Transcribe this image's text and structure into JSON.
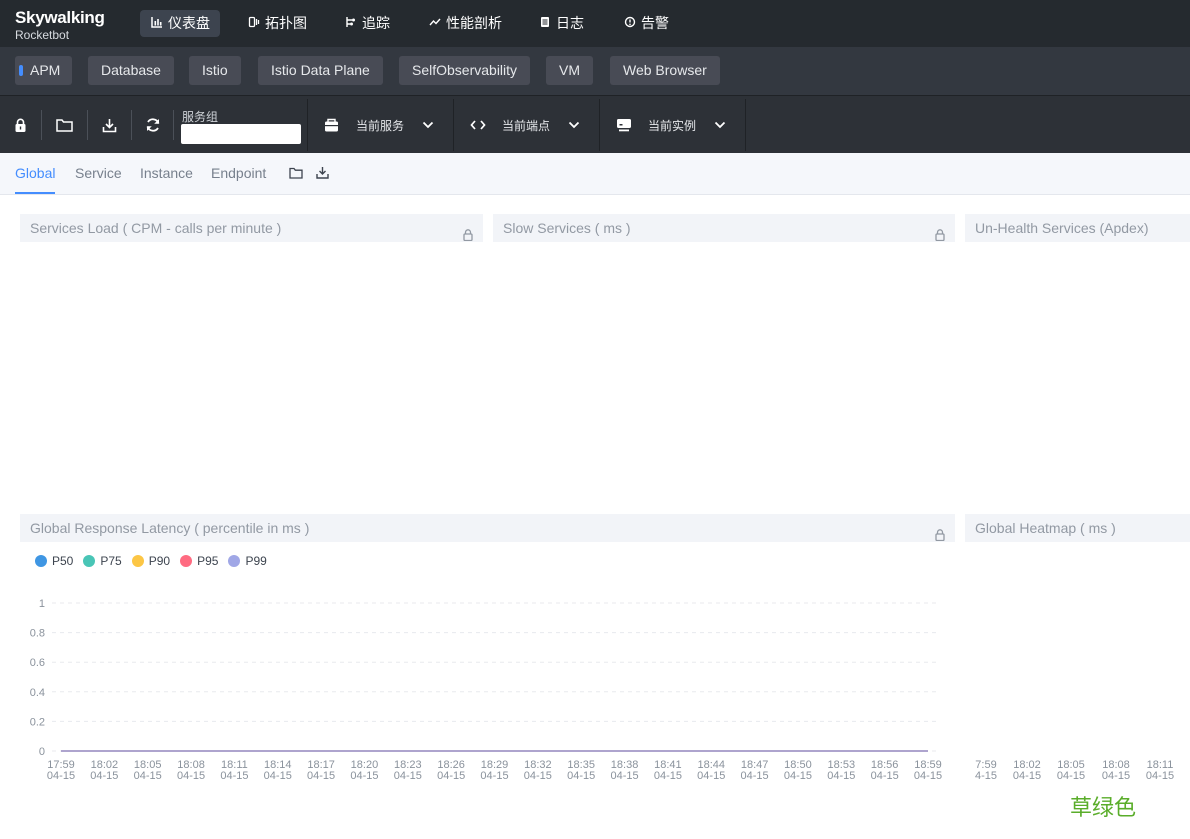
{
  "brand": {
    "name": "Skywalking",
    "sub": "Rocketbot"
  },
  "nav": [
    {
      "label": "仪表盘",
      "icon": "dashboard-icon",
      "active": true
    },
    {
      "label": "拓扑图",
      "icon": "topology-icon",
      "active": false
    },
    {
      "label": "追踪",
      "icon": "trace-icon",
      "active": false
    },
    {
      "label": "性能剖析",
      "icon": "profile-icon",
      "active": false
    },
    {
      "label": "日志",
      "icon": "log-icon",
      "active": false
    },
    {
      "label": "告警",
      "icon": "alarm-icon",
      "active": false
    }
  ],
  "groups": [
    "APM",
    "Database",
    "Istio",
    "Istio Data Plane",
    "SelfObservability",
    "VM",
    "Web Browser"
  ],
  "toolbar": {
    "service_group_label": "服务组",
    "service_group_value": "",
    "current_service": "当前服务",
    "current_endpoint": "当前端点",
    "current_instance": "当前实例"
  },
  "page_tabs": [
    "Global",
    "Service",
    "Instance",
    "Endpoint"
  ],
  "panels": {
    "services_load": "Services Load ( CPM - calls per minute )",
    "slow_services": "Slow Services ( ms )",
    "unhealth_services": "Un-Health Services (Apdex)",
    "global_latency": "Global Response Latency ( percentile in ms )",
    "global_heatmap": "Global Heatmap ( ms )"
  },
  "colors": {
    "accent": "#448dfe",
    "p50": "#3f96e3",
    "p75": "#49c5b6",
    "p90": "#fcc645",
    "p95": "#ff6b81",
    "p99": "#a0a7e6"
  },
  "chart_data": [
    {
      "type": "line",
      "title": "Global Response Latency ( percentile in ms )",
      "series": [
        {
          "name": "P50",
          "values": [
            0,
            0,
            0,
            0,
            0,
            0,
            0,
            0,
            0,
            0,
            0,
            0,
            0,
            0,
            0,
            0,
            0,
            0,
            0,
            0,
            0
          ]
        },
        {
          "name": "P75",
          "values": [
            0,
            0,
            0,
            0,
            0,
            0,
            0,
            0,
            0,
            0,
            0,
            0,
            0,
            0,
            0,
            0,
            0,
            0,
            0,
            0,
            0
          ]
        },
        {
          "name": "P90",
          "values": [
            0,
            0,
            0,
            0,
            0,
            0,
            0,
            0,
            0,
            0,
            0,
            0,
            0,
            0,
            0,
            0,
            0,
            0,
            0,
            0,
            0
          ]
        },
        {
          "name": "P95",
          "values": [
            0,
            0,
            0,
            0,
            0,
            0,
            0,
            0,
            0,
            0,
            0,
            0,
            0,
            0,
            0,
            0,
            0,
            0,
            0,
            0,
            0
          ]
        },
        {
          "name": "P99",
          "values": [
            0,
            0,
            0,
            0,
            0,
            0,
            0,
            0,
            0,
            0,
            0,
            0,
            0,
            0,
            0,
            0,
            0,
            0,
            0,
            0,
            0
          ]
        }
      ],
      "categories": [
        [
          "17:59",
          "04-15"
        ],
        [
          "18:02",
          "04-15"
        ],
        [
          "18:05",
          "04-15"
        ],
        [
          "18:08",
          "04-15"
        ],
        [
          "18:11",
          "04-15"
        ],
        [
          "18:14",
          "04-15"
        ],
        [
          "18:17",
          "04-15"
        ],
        [
          "18:20",
          "04-15"
        ],
        [
          "18:23",
          "04-15"
        ],
        [
          "18:26",
          "04-15"
        ],
        [
          "18:29",
          "04-15"
        ],
        [
          "18:32",
          "04-15"
        ],
        [
          "18:35",
          "04-15"
        ],
        [
          "18:38",
          "04-15"
        ],
        [
          "18:41",
          "04-15"
        ],
        [
          "18:44",
          "04-15"
        ],
        [
          "18:47",
          "04-15"
        ],
        [
          "18:50",
          "04-15"
        ],
        [
          "18:53",
          "04-15"
        ],
        [
          "18:56",
          "04-15"
        ],
        [
          "18:59",
          "04-15"
        ]
      ],
      "yticks": [
        "0",
        "0.2",
        "0.4",
        "0.6",
        "0.8",
        "1"
      ],
      "ylim": [
        0,
        1
      ],
      "grid": true,
      "legend": "top-left"
    },
    {
      "type": "heatmap",
      "title": "Global Heatmap ( ms )",
      "categories": [
        [
          "7:59",
          "4-15"
        ],
        [
          "18:02",
          "04-15"
        ],
        [
          "18:05",
          "04-15"
        ],
        [
          "18:08",
          "04-15"
        ],
        [
          "18:11",
          "04-15"
        ]
      ]
    }
  ],
  "watermark": "草绿色"
}
